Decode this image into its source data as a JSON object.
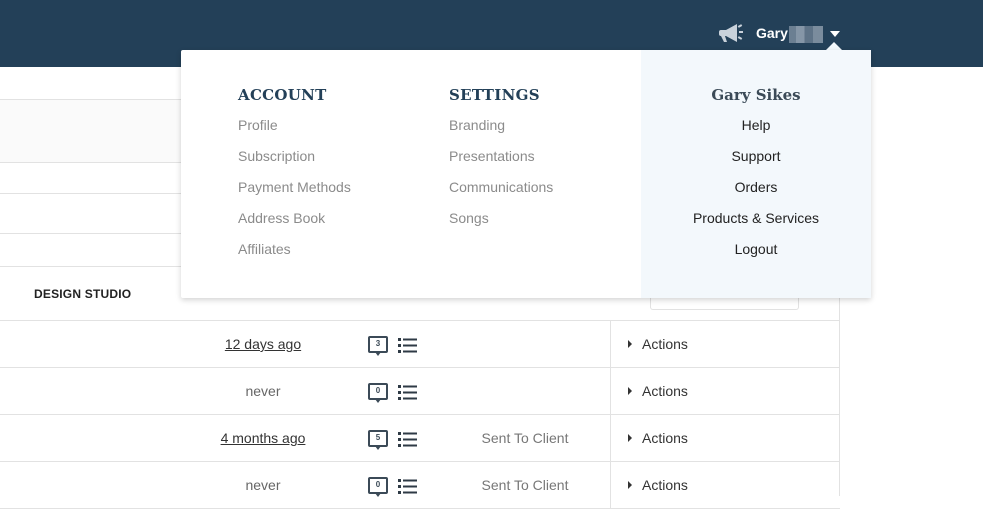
{
  "topbar": {
    "user_first_name": "Gary",
    "megaphone_icon": "megaphone-icon",
    "caret_icon": "caret-down-icon",
    "background": "#234058"
  },
  "table": {
    "column_header": "DESIGN STUDIO",
    "rows": [
      {
        "when": "12 days ago",
        "when_link": true,
        "comments": "3",
        "status": "",
        "actions": "Actions"
      },
      {
        "when": "never",
        "when_link": false,
        "comments": "0",
        "status": "",
        "actions": "Actions"
      },
      {
        "when": "4 months ago",
        "when_link": true,
        "comments": "5",
        "status": "Sent To Client",
        "actions": "Actions"
      },
      {
        "when": "never",
        "when_link": false,
        "comments": "0",
        "status": "Sent To Client",
        "actions": "Actions"
      }
    ]
  },
  "dropdown": {
    "account": {
      "heading": "ACCOUNT",
      "items": [
        "Profile",
        "Subscription",
        "Payment Methods",
        "Address Book",
        "Affiliates"
      ]
    },
    "settings": {
      "heading": "SETTINGS",
      "items": [
        "Branding",
        "Presentations",
        "Communications",
        "Songs"
      ]
    },
    "user": {
      "heading": "Gary Sikes",
      "items": [
        "Help",
        "Support",
        "Orders",
        "Products & Services",
        "Logout"
      ]
    },
    "accent": "#234058",
    "panel_bg": "#f3f8fc"
  }
}
